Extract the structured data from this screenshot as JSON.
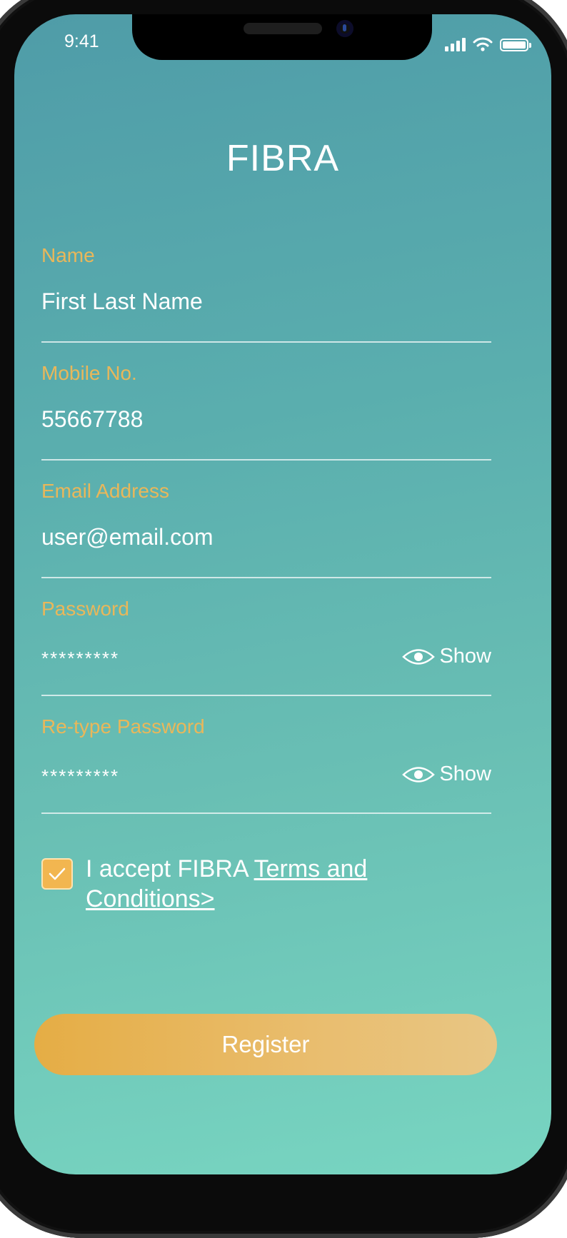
{
  "status_bar": {
    "time": "9:41",
    "icons": [
      "cellular-signal-icon",
      "wifi-icon",
      "battery-icon"
    ]
  },
  "app": {
    "title": "FIBRA"
  },
  "form": {
    "name": {
      "label": "Name",
      "value": "First Last Name"
    },
    "mobile": {
      "label": "Mobile No.",
      "value": "55667788"
    },
    "email": {
      "label": "Email Address",
      "value": "user@email.com"
    },
    "password": {
      "label": "Password",
      "value": "*********",
      "toggle_label": "Show",
      "toggle_icon": "eye-icon"
    },
    "retype_password": {
      "label": "Re-type Password",
      "value": "*********",
      "toggle_label": "Show",
      "toggle_icon": "eye-icon"
    }
  },
  "terms": {
    "checked": true,
    "text": "I accept FIBRA ",
    "link_line1": "Terms and",
    "link_line2": "Conditions>"
  },
  "actions": {
    "register_label": "Register"
  },
  "colors": {
    "label_accent": "#e9b75a",
    "button_start": "#e5ad45",
    "button_end": "#e8c684",
    "background_top": "#4f9ca8",
    "background_bottom": "#78d5c1"
  }
}
